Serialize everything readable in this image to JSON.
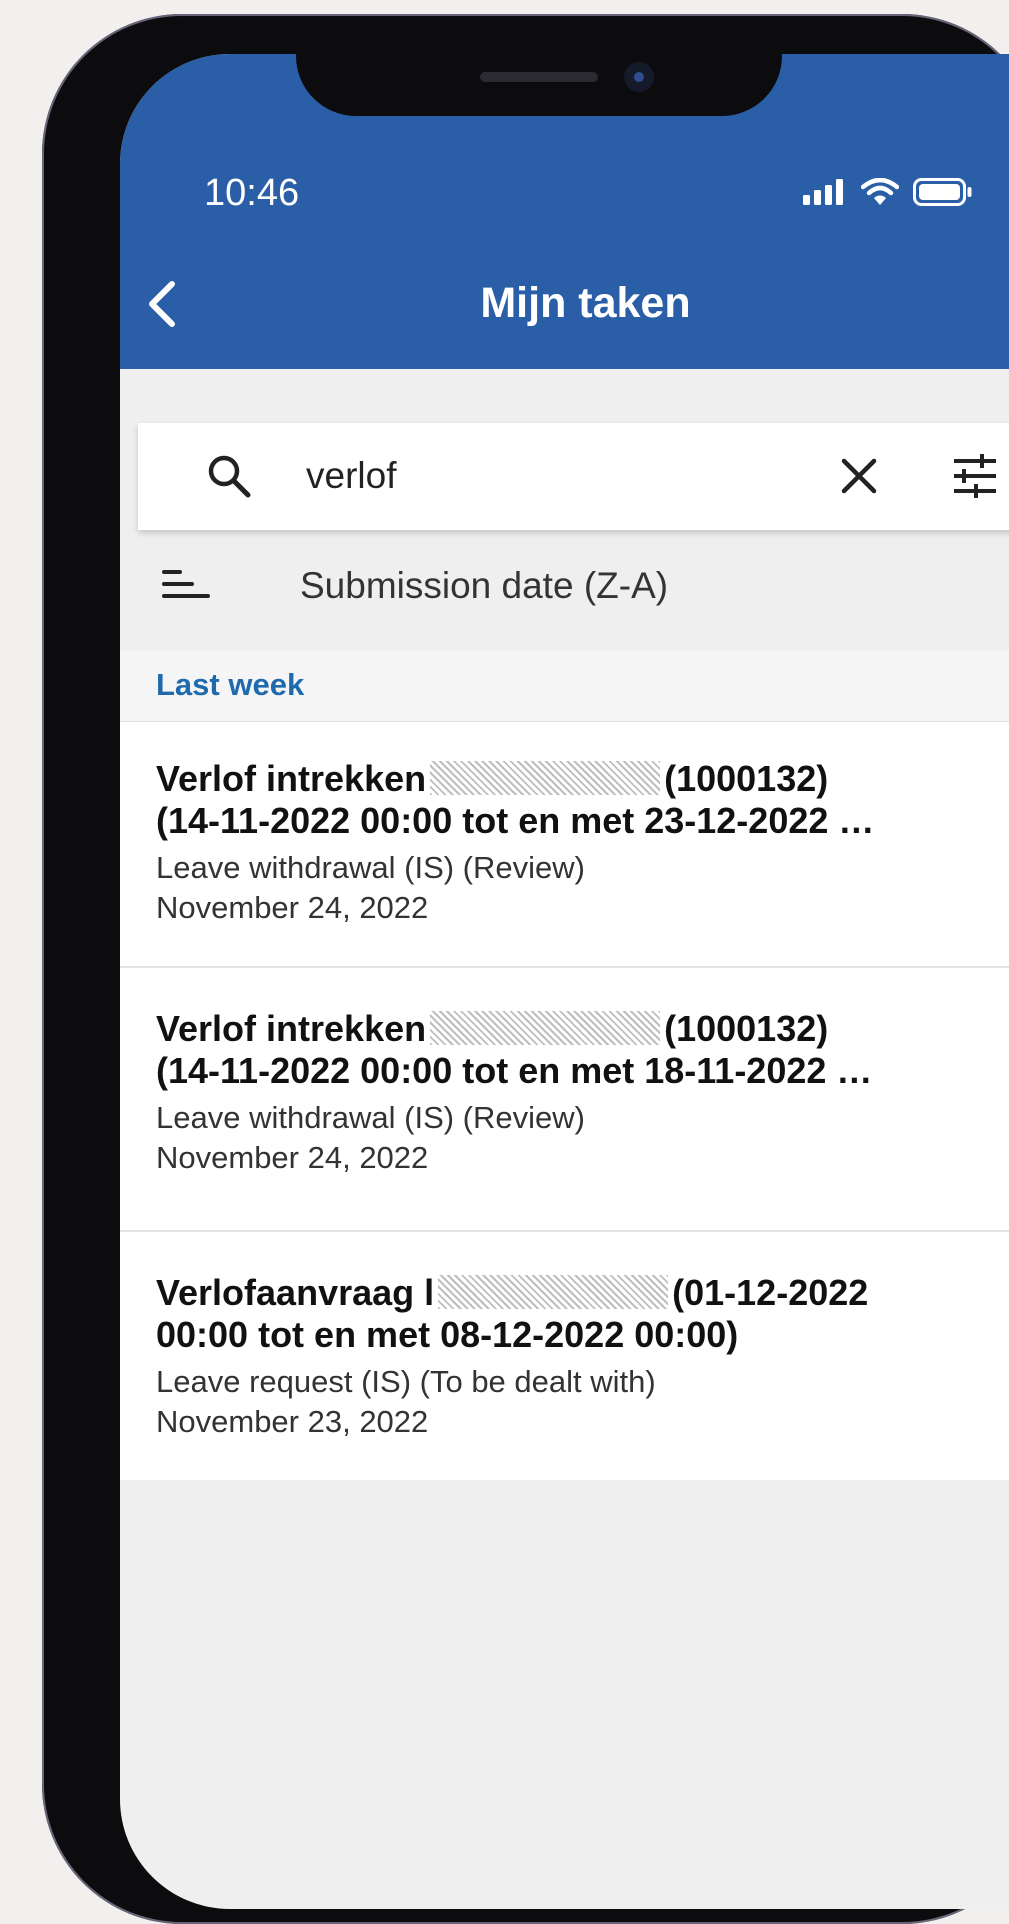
{
  "status_bar": {
    "time": "10:46"
  },
  "header": {
    "title": "Mijn taken"
  },
  "search": {
    "value": "verlof"
  },
  "sort": {
    "label": "Submission date (Z-A)"
  },
  "section": {
    "label": "Last week"
  },
  "items": [
    {
      "title_part1": "Verlof intrekken",
      "title_part2": "(1000132)",
      "title_line2": "(14-11-2022 00:00 tot en met 23-12-2022 …",
      "subtitle": "Leave withdrawal (IS) (Review)",
      "date": "November 24, 2022"
    },
    {
      "title_part1": "Verlof intrekken",
      "title_part2": "(1000132)",
      "title_line2": "(14-11-2022 00:00 tot en met 18-11-2022 …",
      "subtitle": "Leave withdrawal (IS) (Review)",
      "date": "November 24, 2022"
    },
    {
      "title_part1": "Verlofaanvraag l",
      "title_part2": "(01-12-2022",
      "title_line2": "00:00 tot en met 08-12-2022 00:00)",
      "subtitle": "Leave request (IS) (To be dealt with)",
      "date": "November 23, 2022"
    }
  ],
  "colors": {
    "header_blue": "#2a5fa7",
    "section_label": "#1f6aac"
  },
  "icons": [
    "back-arrow-icon",
    "search-icon",
    "close-icon",
    "filter-sliders-icon",
    "sort-icon",
    "signal-icon",
    "wifi-icon",
    "battery-icon"
  ]
}
